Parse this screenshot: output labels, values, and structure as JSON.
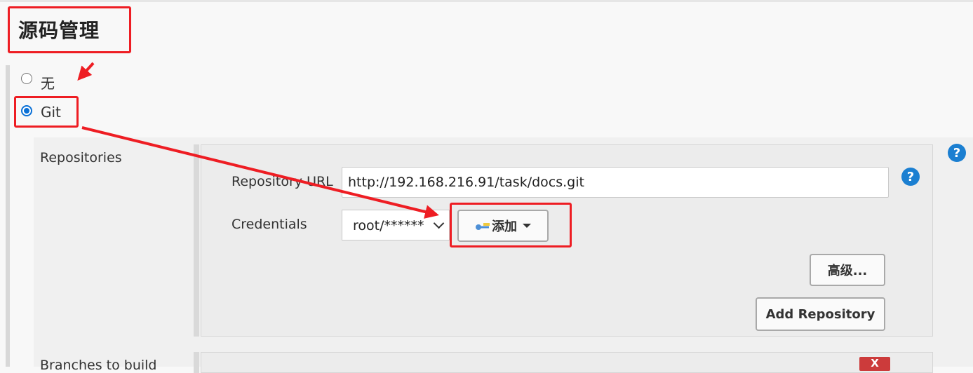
{
  "section": {
    "title": "源码管理"
  },
  "scm_options": [
    {
      "label": "无",
      "selected": false
    },
    {
      "label": "Git",
      "selected": true
    }
  ],
  "git": {
    "repositories_label": "Repositories",
    "repository_url_label": "Repository URL",
    "repository_url_value": "http://192.168.216.91/task/docs.git",
    "credentials_label": "Credentials",
    "credentials_value": "root/******",
    "add_button_label": "添加",
    "advanced_button_label": "高级...",
    "add_repository_button_label": "Add Repository",
    "branches_label": "Branches to build",
    "delete_label": "X"
  },
  "icons": {
    "help": "question-mark-icon",
    "key": "key-icon",
    "dropdown": "chevron-down-icon",
    "caret": "caret-down-icon"
  },
  "colors": {
    "annotation": "#ee1d23",
    "help_blue": "#1b7fd1",
    "radio_blue": "#0a70d6",
    "delete_red": "#cc3b3b"
  }
}
